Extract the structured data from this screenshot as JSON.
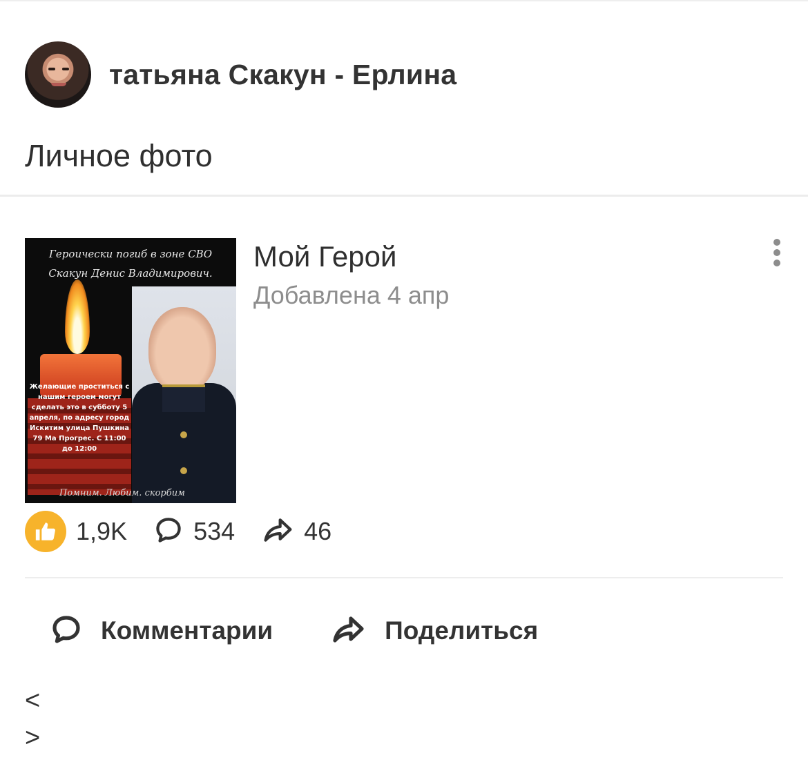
{
  "author": {
    "name": "татьяна Скакун - Ерлина"
  },
  "album": {
    "title": "Личное фото"
  },
  "post": {
    "title": "Мой Герой",
    "date": "Добавлена 4 апр",
    "photo": {
      "caption_line1": "Героически погиб в зоне СВО",
      "caption_line2": "Скакун Денис Владимирович.",
      "notice": "Желающие проститься с нашим героем могут сделать это в субботу 5 апреля, по адресу город Искитим улица Пушкина 79 Ма Прогрес. С 11:00 до 12:00",
      "signature": "Помним. Любим. скорбим"
    }
  },
  "stats": {
    "likes": "1,9K",
    "comments": "534",
    "shares": "46"
  },
  "actions": {
    "comments_label": "Комментарии",
    "share_label": "Поделиться"
  },
  "nav": {
    "prev": "<",
    "next": ">"
  },
  "colors": {
    "like_accent": "#f7b32b",
    "muted_text": "#8d8d8d"
  },
  "icons": {
    "more": "more-vertical-icon",
    "like": "thumbs-up-icon",
    "comment": "speech-bubble-icon",
    "share": "share-arrow-icon"
  }
}
